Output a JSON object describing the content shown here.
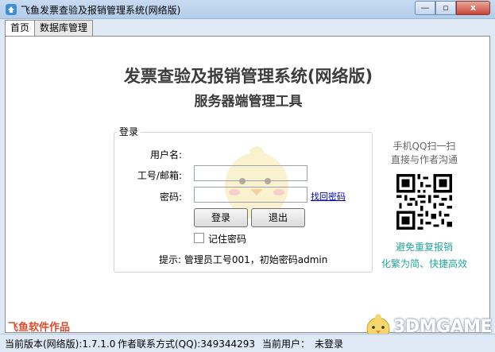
{
  "window": {
    "title": "飞鱼发票查验及报销管理系统(网络版)",
    "minimize": "—",
    "maximize": "▫",
    "close": "x"
  },
  "tabs": [
    {
      "label": "首页",
      "active": true
    },
    {
      "label": "数据库管理",
      "active": false
    }
  ],
  "main": {
    "title": "发票查验及报销管理系统(网络版)",
    "subtitle": "服务器端管理工具"
  },
  "login": {
    "legend": "登录",
    "username_label": "用户名:",
    "username_value": "",
    "employee_label": "工号/邮箱:",
    "employee_value": "",
    "password_label": "密码:",
    "password_value": "",
    "recover_link": "找回密码",
    "login_button": "登录",
    "exit_button": "退出",
    "remember_label": "记住密码",
    "remember_checked": false,
    "hint": "提示: 管理员工号001，初始密码admin"
  },
  "side": {
    "qq_line1": "手机QQ扫一扫",
    "qq_line2": "直接与作者沟通",
    "promo_line1": "避免重复报销",
    "promo_line2": "化繁为简、快捷高效"
  },
  "brand": "飞鱼软件作品",
  "status": {
    "version": "当前版本(网络版):1.7.1.0",
    "contact": "作者联系方式(QQ):349344293",
    "user_label": "当前用户：",
    "user_value": "未登录"
  },
  "watermark": "3DMGAME",
  "colors": {
    "accent_teal": "#26a69a",
    "brand_red": "#e04a2c",
    "link_blue": "#0000cc"
  }
}
